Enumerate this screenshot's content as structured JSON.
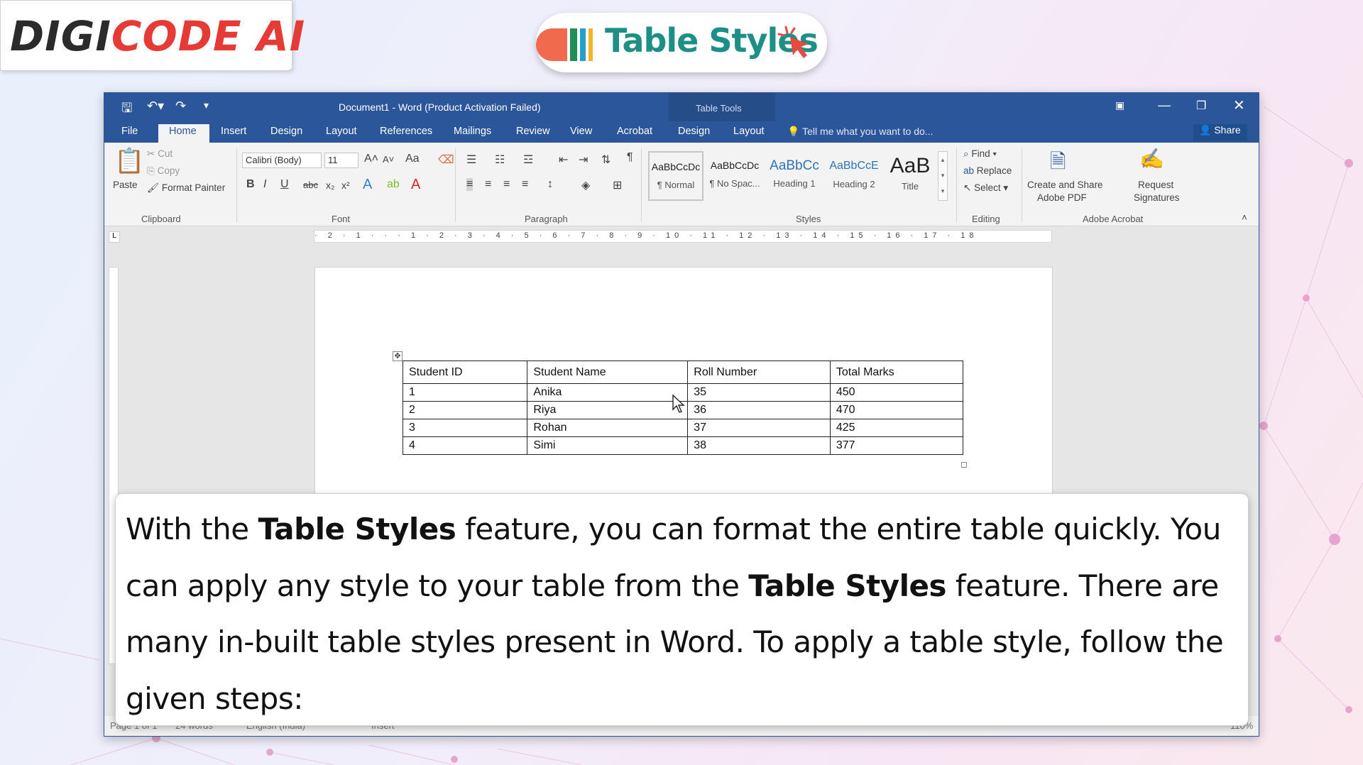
{
  "brand": {
    "logo_part1": "DIGI",
    "logo_part2": "CODE AI"
  },
  "banner": {
    "title": "Table Styles"
  },
  "window": {
    "title": "Document1 - Word (Product Activation Failed)",
    "context_label": "Table Tools",
    "tell_me": "Tell me what you want to do...",
    "share": "Share",
    "tabs": [
      "File",
      "Home",
      "Insert",
      "Design",
      "Layout",
      "References",
      "Mailings",
      "Review",
      "View",
      "Acrobat",
      "Design",
      "Layout"
    ]
  },
  "ribbon": {
    "clipboard": {
      "paste": "Paste",
      "cut": "Cut",
      "copy": "Copy",
      "format_painter": "Format Painter",
      "label": "Clipboard"
    },
    "font": {
      "name": "Calibri (Body)",
      "size": "11",
      "change_case": "Aa",
      "label": "Font"
    },
    "paragraph": {
      "label": "Paragraph"
    },
    "styles": {
      "label": "Styles",
      "items": [
        {
          "sample": "AaBbCcDc",
          "name": "¶ Normal"
        },
        {
          "sample": "AaBbCcDc",
          "name": "¶ No Spac..."
        },
        {
          "sample": "AaBbCc",
          "name": "Heading 1"
        },
        {
          "sample": "AaBbCcE",
          "name": "Heading 2"
        },
        {
          "sample": "AaB",
          "name": "Title"
        }
      ]
    },
    "editing": {
      "find": "Find",
      "replace": "Replace",
      "select": "Select",
      "label": "Editing"
    },
    "acrobat": {
      "create_pdf_1": "Create and Share",
      "create_pdf_2": "Adobe PDF",
      "request_sig_1": "Request",
      "request_sig_2": "Signatures",
      "label": "Adobe Acrobat"
    }
  },
  "ruler": {
    "marks": "· 2 · 1 · · · 1 · 2 · 3 · 4 · 5 · 6 · 7 · 8 · 9 · 10 · 11 · 12 · 13 · 14 · 15 · 16 · 17 · 18"
  },
  "table": {
    "headers": [
      "Student ID",
      "Student Name",
      "Roll Number",
      "Total Marks"
    ],
    "rows": [
      [
        "1",
        "Anika",
        "35",
        "450"
      ],
      [
        "2",
        "Riya",
        "36",
        "470"
      ],
      [
        "3",
        "Rohan",
        "37",
        "425"
      ],
      [
        "4",
        "Simi",
        "38",
        "377"
      ]
    ]
  },
  "statusbar": {
    "page": "Page 1 of 1",
    "words": "24 words",
    "language": "English (India)",
    "mode": "Insert",
    "zoom": "110%"
  },
  "caption": {
    "s1_pre": "With the ",
    "s1_bold": "Table Styles",
    "s1_post": " feature, you can format the entire table quickly. You can apply any style to your table from the ",
    "s2_bold": "Table Styles",
    "s2_post": " feature. There are many in-built table styles present in Word. To apply a table style, follow the given steps:"
  },
  "colors": {
    "word_blue": "#2b579a",
    "brand_red": "#e53a35",
    "title_teal": "#1e8f86"
  }
}
